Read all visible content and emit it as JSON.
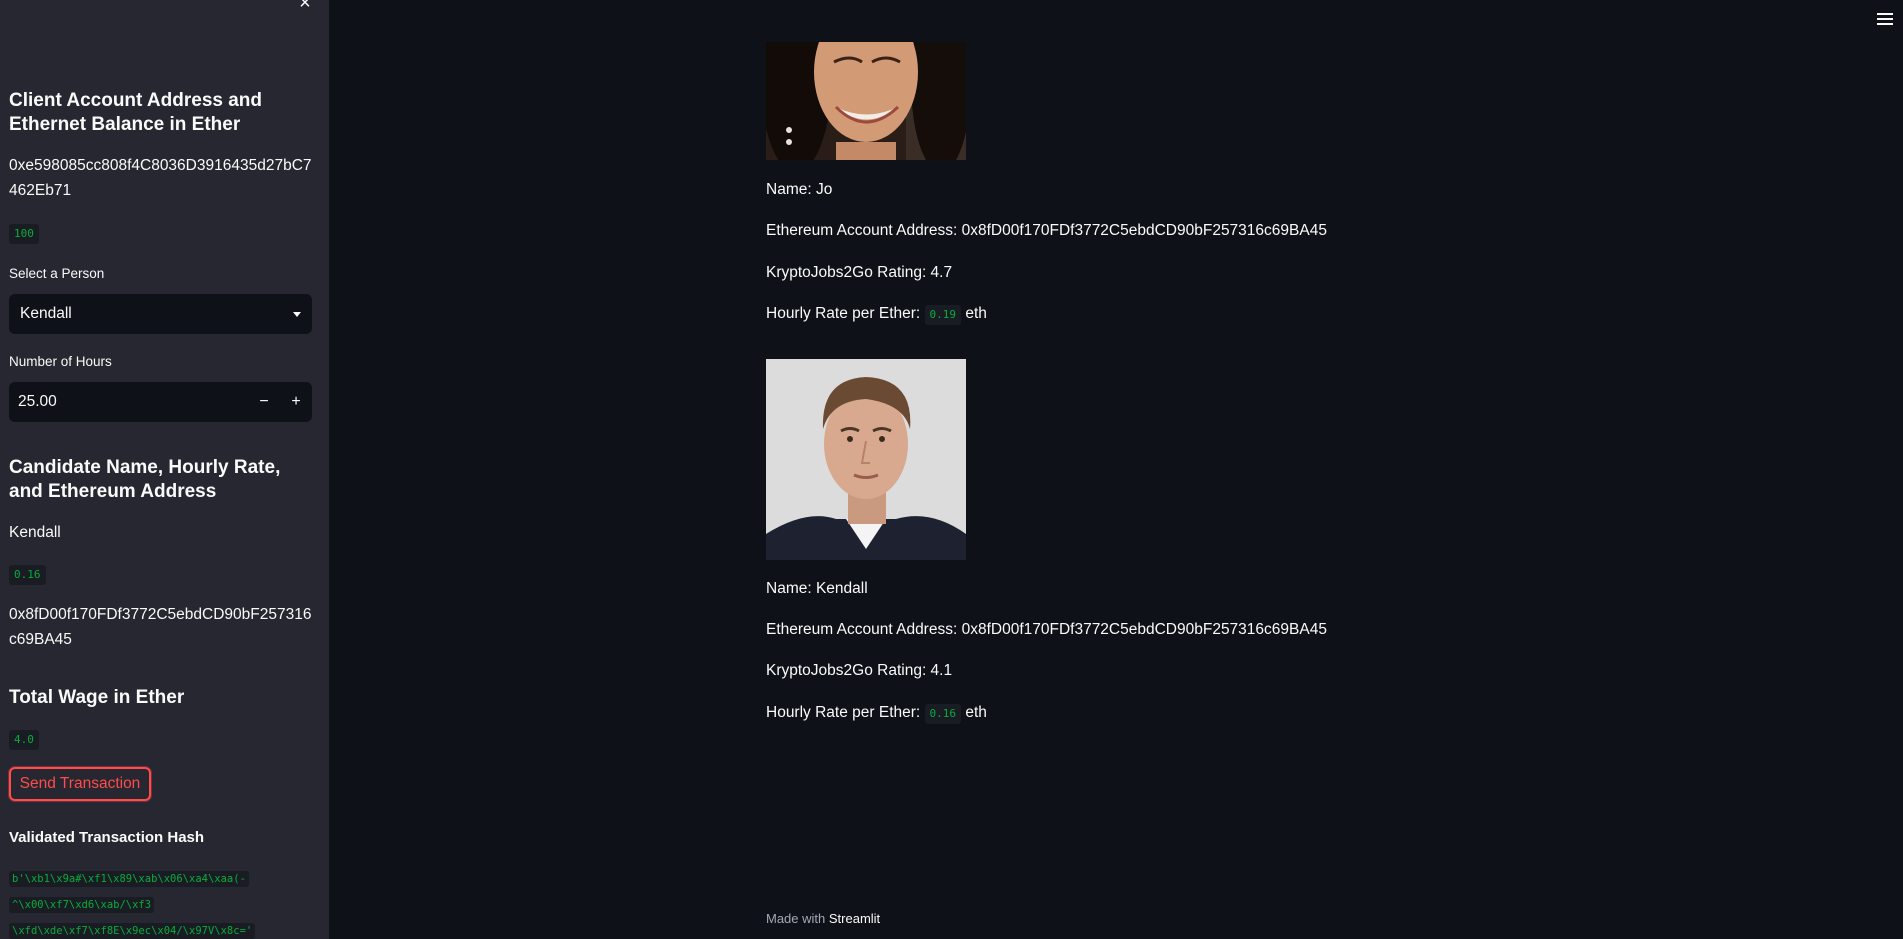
{
  "sidebar": {
    "client_heading": "Client Account Address and Ethernet Balance in Ether",
    "client_address": "0xe598085cc808f4C8036D3916435d27bC7462Eb71",
    "client_balance": "100",
    "select_label": "Select a Person",
    "select_value": "Kendall",
    "hours_label": "Number of Hours",
    "hours_value": "25.00",
    "candidate_heading": "Candidate Name, Hourly Rate, and Ethereum Address",
    "candidate_name": "Kendall",
    "candidate_rate": "0.16",
    "candidate_address": "0x8fD00f170FDf3772C5ebdCD90bF257316c69BA45",
    "wage_heading": "Total Wage in Ether",
    "wage_value": "4.0",
    "send_button": "Send Transaction",
    "hash_heading": "Validated Transaction Hash",
    "hash_lines": [
      "b'\\xb1\\x9a#\\xf1\\x89\\xab\\x06\\xa4\\xaa(-",
      "^\\x00\\xf7\\xd6\\xab/\\xf3",
      "\\xfd\\xde\\xf7\\xf8E\\x9ec\\x04/\\x97V\\x8c='"
    ],
    "close_icon": "close-icon"
  },
  "candidates": [
    {
      "name_line": "Name: Jo",
      "address_line": "Ethereum Account Address: 0x8fD00f170FDf3772C5ebdCD90bF257316c69BA45",
      "rating_line": "KryptoJobs2Go Rating: 4.7",
      "rate_prefix": "Hourly Rate per Ether:",
      "rate_value": "0.19",
      "rate_suffix": "eth"
    },
    {
      "name_line": "Name: Kendall",
      "address_line": "Ethereum Account Address: 0x8fD00f170FDf3772C5ebdCD90bF257316c69BA45",
      "rating_line": "KryptoJobs2Go Rating: 4.1",
      "rate_prefix": "Hourly Rate per Ether:",
      "rate_value": "0.16",
      "rate_suffix": "eth"
    }
  ],
  "footer": {
    "prefix": "Made with",
    "brand": "Streamlit"
  },
  "colors": {
    "accent": "#ff4b4b",
    "code_green": "#09ab3b",
    "bg": "#0e1117",
    "sidebar_bg": "#262730"
  }
}
